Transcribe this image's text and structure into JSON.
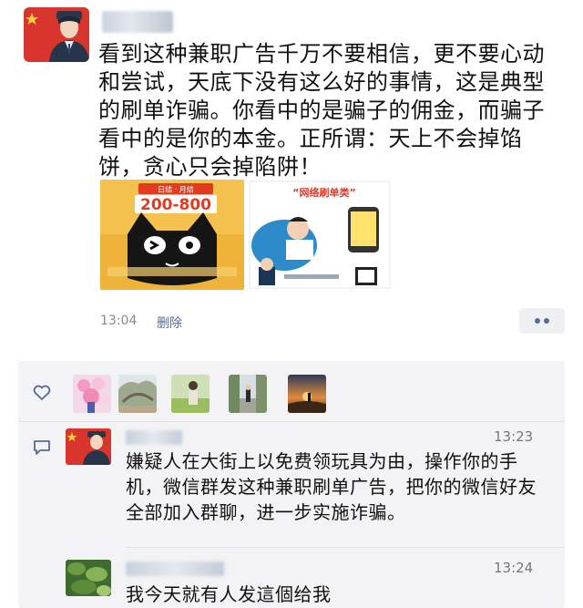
{
  "post": {
    "author_avatar": "police-officer-avatar",
    "text": "看到这种兼职广告千万不要相信，更不要心动和尝试，天底下没有这么好的事情，这是典型的刷单诈骗。你看中的是骗子的佣金，而骗子看中的是你的本金。正所谓：天上不会掉馅饼，贪心只会掉陷阱！",
    "images": [
      {
        "icon": "tmall-cat-ad-image",
        "banner_text": "200-800",
        "top_text": "日结 · 月结"
      },
      {
        "icon": "online-brush-order-cartoon-image",
        "title": "“网络刷单类”"
      }
    ],
    "time": "13:04",
    "delete_label": "删除"
  },
  "likes": {
    "icon": "heart-icon",
    "avatars": [
      "avatar-flowers",
      "avatar-tree",
      "avatar-person-grass",
      "avatar-street",
      "avatar-sunset"
    ]
  },
  "comments": [
    {
      "avatar": "police-officer-avatar",
      "time": "13:23",
      "text": "嫌疑人在大街上以免费领玩具为由，操作你的手机，微信群发这种兼职刷单广告，把你的微信好友全部加入群聊，进一步实施诈骗。"
    },
    {
      "avatar": "avatar-green-leaves",
      "time": "13:24",
      "text": "我今天就有人发這個给我"
    }
  ],
  "colors": {
    "link": "#576b95",
    "panel_bg": "#f3f3f5",
    "accent_red": "#d7322b"
  }
}
